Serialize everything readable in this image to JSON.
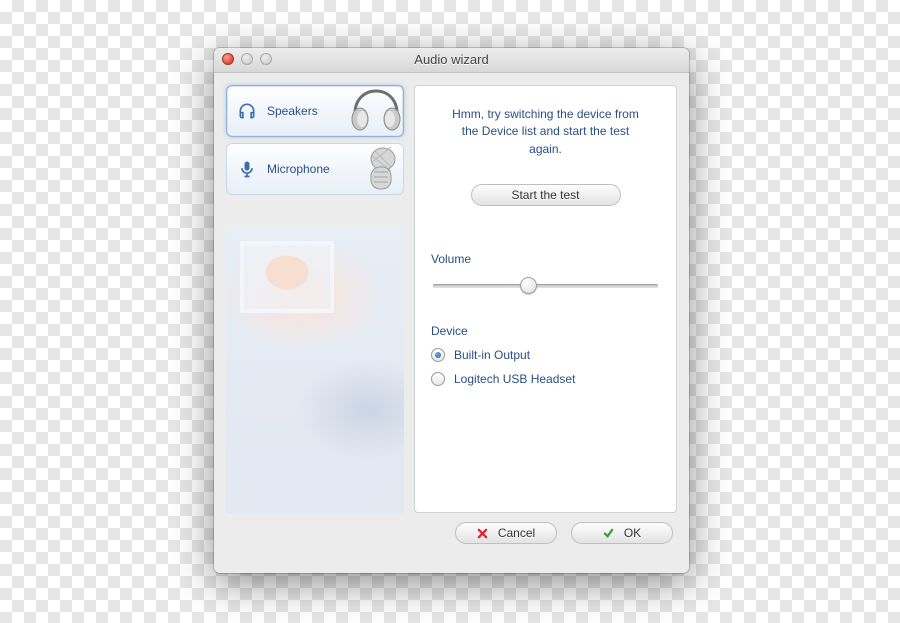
{
  "window": {
    "title": "Audio wizard"
  },
  "sidebar": {
    "items": [
      {
        "label": "Speakers",
        "icon": "headphones-icon",
        "selected": true
      },
      {
        "label": "Microphone",
        "icon": "microphone-icon",
        "selected": false
      }
    ]
  },
  "main": {
    "hint": "Hmm, try switching the device from the Device list and start the test again.",
    "start_button": "Start the test",
    "volume": {
      "label": "Volume",
      "value": 42,
      "min": 0,
      "max": 100
    },
    "device": {
      "label": "Device",
      "selected": 0,
      "options": [
        "Built-in Output",
        "Logitech USB Headset"
      ]
    }
  },
  "footer": {
    "cancel": "Cancel",
    "ok": "OK"
  },
  "colors": {
    "link": "#2b4e86"
  }
}
